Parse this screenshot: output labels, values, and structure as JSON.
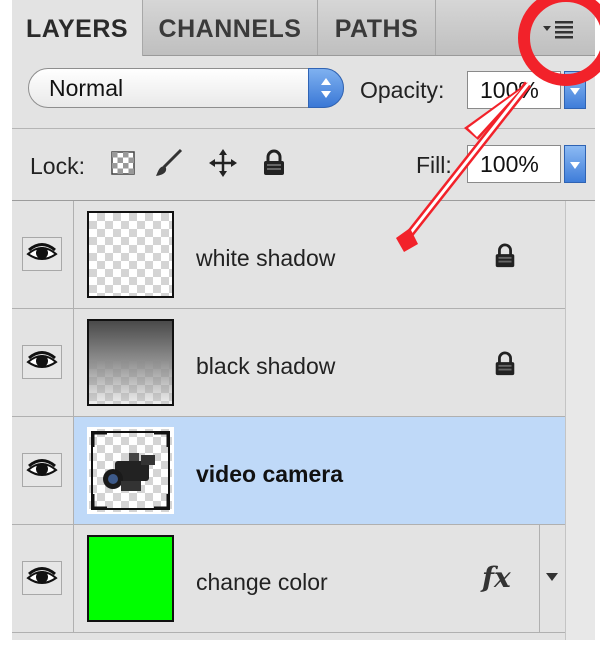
{
  "tabs": [
    {
      "label": "LAYERS",
      "active": true
    },
    {
      "label": "CHANNELS",
      "active": false
    },
    {
      "label": "PATHS",
      "active": false
    }
  ],
  "panel_menu_icon": "panel-menu-icon",
  "blend": {
    "mode": "Normal"
  },
  "opacity": {
    "label": "Opacity:",
    "value": "100%"
  },
  "lock": {
    "label": "Lock:",
    "icons": [
      "transparent-pixels-lock-icon",
      "brush-lock-icon",
      "move-lock-icon",
      "padlock-icon"
    ]
  },
  "fill": {
    "label": "Fill:",
    "value": "100%"
  },
  "layers": [
    {
      "name": "white shadow",
      "thumbnail": "checkerboard",
      "locked": true,
      "visible": true,
      "selected": false
    },
    {
      "name": "black shadow",
      "thumbnail": "dark-gradient",
      "locked": true,
      "visible": true,
      "selected": false
    },
    {
      "name": "video camera",
      "thumbnail": "video-camera",
      "locked": false,
      "visible": true,
      "selected": true
    },
    {
      "name": "change color",
      "thumbnail": "green-fill",
      "locked": false,
      "visible": true,
      "selected": false,
      "effects": "fx"
    }
  ],
  "colors": {
    "selected_row": "#bfd9f8",
    "annotation": "#f2222a",
    "layer_fill_green": "#00ff00"
  }
}
